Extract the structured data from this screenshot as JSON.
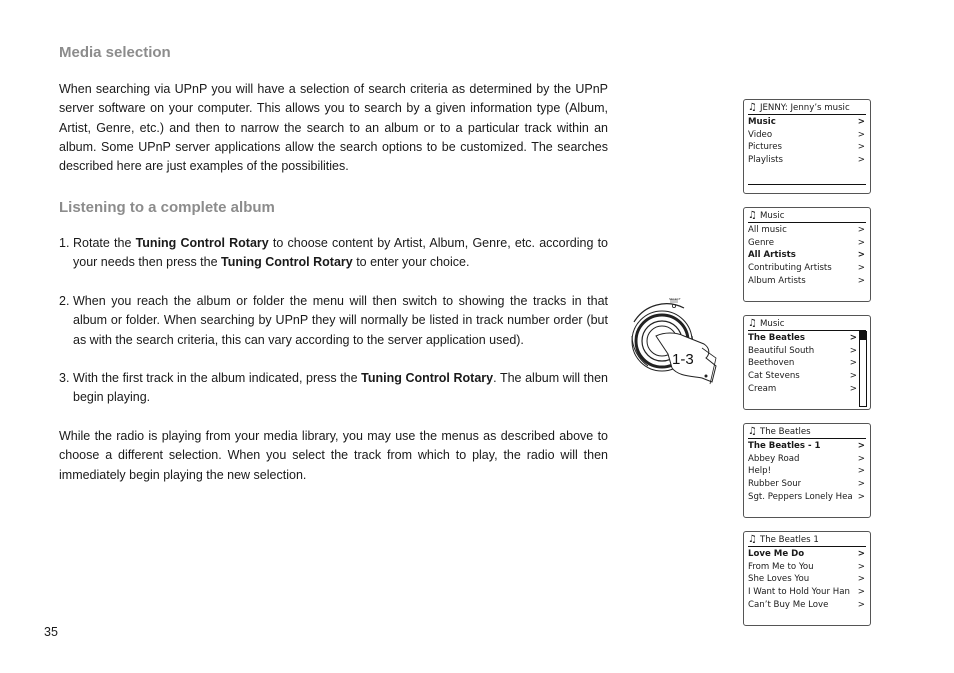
{
  "headings": {
    "media_selection": "Media selection",
    "listening": "Listening to a complete album"
  },
  "intro": "When searching via UPnP you will have a selection of search criteria as determined by the UPnP server software on your computer. This allows you to search by a given information type (Album, Artist, Genre, etc.) and then to narrow the search to an album or to a particular track within an album. Some UPnP server applications allow the search options to be customized. The searches described here are just examples of the possibilities.",
  "steps": [
    {
      "num": "1.",
      "pre": "Rotate the ",
      "bold1": "Tuning Control Rotary",
      "mid": " to choose content by Artist, Album, Genre, etc. according to your needs then press the ",
      "bold2": "Tuning Control Rotary",
      "post": " to enter your choice."
    },
    {
      "num": "2.",
      "text": "When you reach the album or folder the menu will then switch to showing the tracks in that album or folder. When searching by UPnP they will normally be listed in track number order (but as with the search criteria, this can vary according to the server application used)."
    },
    {
      "num": "3.",
      "pre": "With the first track in the album indicated, press the ",
      "bold1": "Tuning Control Rotary",
      "post": ". The album will then begin playing."
    }
  ],
  "closing": "While the radio is playing from your media library, you may use the menus as described above to choose a different selection. When you select the track from which to play, the radio will then immediately begin playing the new selection.",
  "page_number": "35",
  "knob": {
    "label": "1-3",
    "top_label": "SELECT"
  },
  "screens": [
    {
      "icon": "music-note-icon",
      "title": "JENNY: Jenny’s music",
      "rows": [
        {
          "label": "Music",
          "arrow": ">",
          "selected": true
        },
        {
          "label": "Video",
          "arrow": ">",
          "selected": false
        },
        {
          "label": "Pictures",
          "arrow": ">",
          "selected": false
        },
        {
          "label": "Playlists",
          "arrow": ">",
          "selected": false
        }
      ]
    },
    {
      "icon": "music-note-icon",
      "title": "Music",
      "rows": [
        {
          "label": "All music",
          "arrow": ">",
          "selected": false
        },
        {
          "label": "Genre",
          "arrow": ">",
          "selected": false
        },
        {
          "label": "All Artists",
          "arrow": ">",
          "selected": true
        },
        {
          "label": "Contributing Artists",
          "arrow": ">",
          "selected": false
        },
        {
          "label": "Album Artists",
          "arrow": ">",
          "selected": false
        }
      ]
    },
    {
      "icon": "music-note-icon",
      "title": "Music",
      "scroll_position": 0,
      "rows": [
        {
          "label": "The Beatles",
          "arrow": ">",
          "selected": true
        },
        {
          "label": "Beautiful South",
          "arrow": ">",
          "selected": false
        },
        {
          "label": "Beethoven",
          "arrow": ">",
          "selected": false
        },
        {
          "label": "Cat Stevens",
          "arrow": ">",
          "selected": false
        },
        {
          "label": "Cream",
          "arrow": ">",
          "selected": false
        }
      ]
    },
    {
      "icon": "music-note-icon",
      "title": "The Beatles",
      "rows": [
        {
          "label": "The Beatles - 1",
          "arrow": ">",
          "selected": true
        },
        {
          "label": "Abbey Road",
          "arrow": ">",
          "selected": false
        },
        {
          "label": "Help!",
          "arrow": ">",
          "selected": false
        },
        {
          "label": "Rubber Sour",
          "arrow": ">",
          "selected": false
        },
        {
          "label": "Sgt. Peppers Lonely Hea",
          "arrow": ">",
          "selected": false
        }
      ]
    },
    {
      "icon": "music-note-icon",
      "title": "The Beatles 1",
      "rows": [
        {
          "label": "Love Me Do",
          "arrow": ">",
          "selected": true
        },
        {
          "label": "From Me to You",
          "arrow": ">",
          "selected": false
        },
        {
          "label": "She Loves You",
          "arrow": ">",
          "selected": false
        },
        {
          "label": "I Want to Hold Your Han",
          "arrow": ">",
          "selected": false
        },
        {
          "label": "Can’t Buy Me Love",
          "arrow": ">",
          "selected": false
        }
      ]
    }
  ]
}
